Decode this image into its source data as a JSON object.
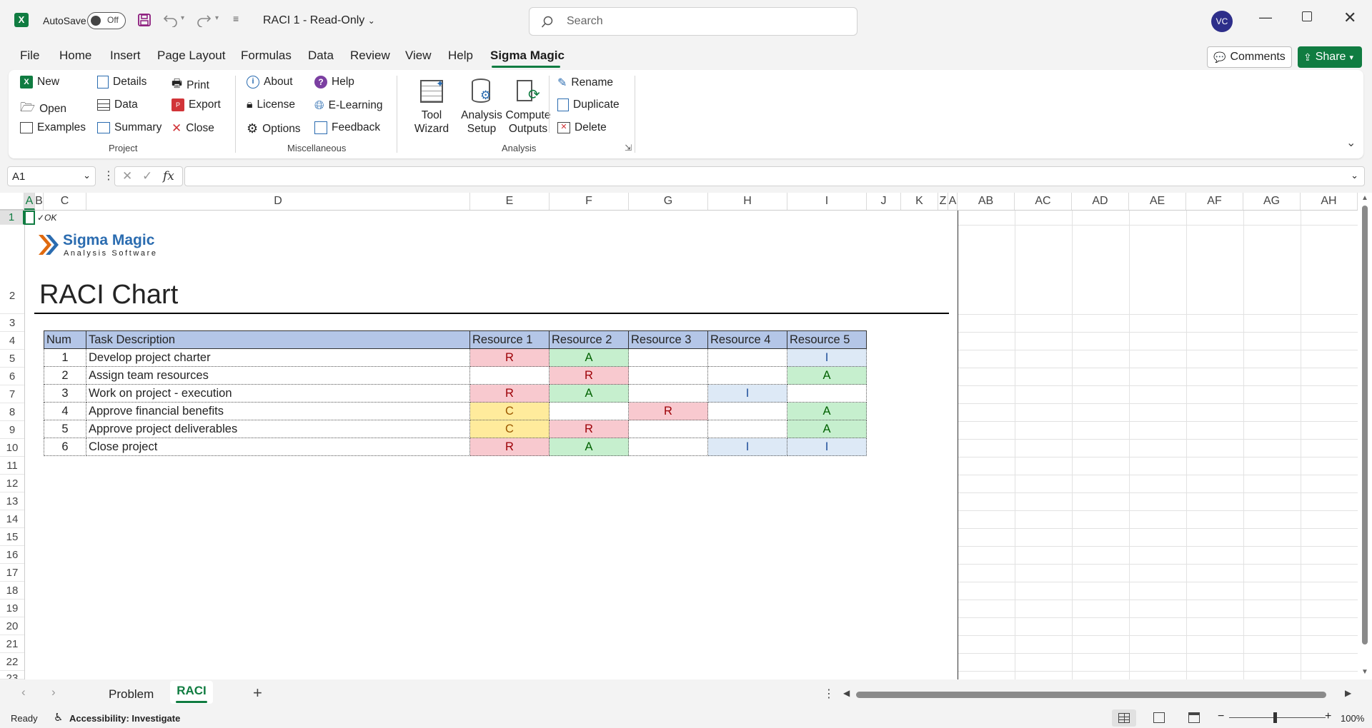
{
  "titlebar": {
    "autosave_label": "AutoSave",
    "autosave_state": "Off",
    "doc_title": "RACI 1  -  Read-Only",
    "search_placeholder": "Search",
    "avatar_initials": "VC"
  },
  "menu_tabs": [
    "File",
    "Home",
    "Insert",
    "Page Layout",
    "Formulas",
    "Data",
    "Review",
    "View",
    "Help",
    "Sigma Magic"
  ],
  "actions": {
    "comments": "Comments",
    "share": "Share"
  },
  "ribbon": {
    "project": {
      "label": "Project",
      "new": "New",
      "open": "Open",
      "examples": "Examples",
      "details": "Details",
      "data": "Data",
      "summary": "Summary",
      "print": "Print",
      "export": "Export",
      "close": "Close"
    },
    "misc": {
      "label": "Miscellaneous",
      "about": "About",
      "license": "License",
      "options": "Options",
      "help": "Help",
      "elearning": "E-Learning",
      "feedback": "Feedback"
    },
    "analysis": {
      "label": "Analysis",
      "tool_wizard_1": "Tool",
      "tool_wizard_2": "Wizard",
      "analysis_setup_1": "Analysis",
      "analysis_setup_2": "Setup",
      "compute_outputs_1": "Compute",
      "compute_outputs_2": "Outputs",
      "rename": "Rename",
      "duplicate": "Duplicate",
      "delete": "Delete"
    }
  },
  "formula_bar": {
    "name_box": "A1",
    "fx": "fx",
    "formula": ""
  },
  "columns": [
    "A",
    "B",
    "C",
    "D",
    "E",
    "F",
    "G",
    "H",
    "I",
    "J",
    "K",
    "Z",
    "A",
    "AB",
    "AC",
    "AD",
    "AE",
    "AF",
    "AG",
    "AH"
  ],
  "rows": [
    "1",
    "2",
    "3",
    "4",
    "5",
    "6",
    "7",
    "8",
    "9",
    "10",
    "11",
    "12",
    "13",
    "14",
    "15",
    "16",
    "17",
    "18",
    "19",
    "20",
    "21",
    "22",
    "23"
  ],
  "sheet": {
    "ok_text": "✓OK",
    "logo_name": "Sigma Magic",
    "logo_sub": "Analysis Software",
    "chart_title": "RACI Chart",
    "table_headers": [
      "Num",
      "Task Description",
      "Resource 1",
      "Resource 2",
      "Resource 3",
      "Resource 4",
      "Resource 5"
    ],
    "table_rows": [
      {
        "num": "1",
        "task": "Develop project charter",
        "r": [
          "R",
          "A",
          "",
          "",
          "I"
        ]
      },
      {
        "num": "2",
        "task": "Assign team resources",
        "r": [
          "",
          "R",
          "",
          "",
          "A"
        ]
      },
      {
        "num": "3",
        "task": "Work on project - execution",
        "r": [
          "R",
          "A",
          "",
          "I",
          ""
        ]
      },
      {
        "num": "4",
        "task": "Approve financial benefits",
        "r": [
          "C",
          "",
          "R",
          "",
          "A"
        ]
      },
      {
        "num": "5",
        "task": "Approve project deliverables",
        "r": [
          "C",
          "R",
          "",
          "",
          "A"
        ]
      },
      {
        "num": "6",
        "task": "Close project",
        "r": [
          "R",
          "A",
          "",
          "I",
          "I"
        ]
      }
    ]
  },
  "sheet_tabs": [
    "Problem",
    "RACI"
  ],
  "status": {
    "ready": "Ready",
    "accessibility": "Accessibility: Investigate",
    "zoom": "100%"
  }
}
